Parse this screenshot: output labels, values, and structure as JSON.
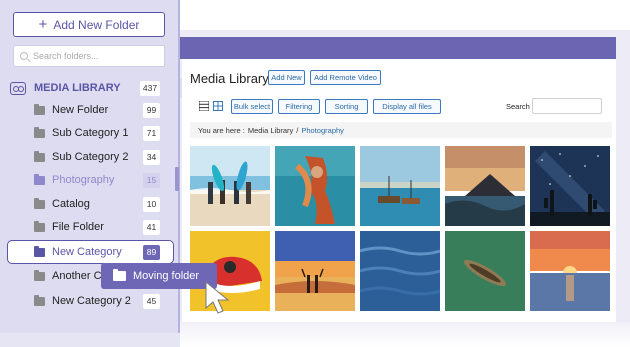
{
  "sidebar": {
    "add_button_label": "Add New Folder",
    "search_placeholder": "Search folders...",
    "library": {
      "label": "MEDIA LIBRARY",
      "count": "437"
    },
    "items": [
      {
        "label": "New Folder",
        "count": "99"
      },
      {
        "label": "Sub Category 1",
        "count": "71"
      },
      {
        "label": "Sub Category 2",
        "count": "34"
      },
      {
        "label": "Photography",
        "count": "15"
      },
      {
        "label": "Catalog",
        "count": "10"
      },
      {
        "label": "File Folder",
        "count": "41"
      },
      {
        "label": "New Category",
        "count": "89"
      },
      {
        "label": "Another Ca",
        "count": ""
      },
      {
        "label": "New Category 2",
        "count": "45"
      }
    ],
    "moving_label": "Moving folder"
  },
  "main": {
    "title": "Media Library",
    "add_new_label": "Add New",
    "add_remote_video_label": "Add Remote Video",
    "toolbar": {
      "bulk_select": "Bulk select",
      "filtering": "Filtering",
      "sorting": "Sorting",
      "display_all": "Display all files",
      "search_label": "Search",
      "search_value": ""
    },
    "breadcrumb": {
      "prefix": "You are here :",
      "root": "Media Library",
      "separator": "/",
      "current": "Photography"
    },
    "thumbnails": [
      "beach-surfers",
      "underwater-dancer",
      "harbor-boats",
      "mountain-lake-sunset",
      "starry-cactus-night",
      "yellow-sneakers",
      "sunset-beach-couple",
      "blue-ocean-waves",
      "boat-on-green-water",
      "ocean-sunset"
    ]
  },
  "colors": {
    "accent": "#5b55a6",
    "accent_light": "#8e88cc",
    "link": "#2b6aa8",
    "topbar": "#6b65b2"
  }
}
